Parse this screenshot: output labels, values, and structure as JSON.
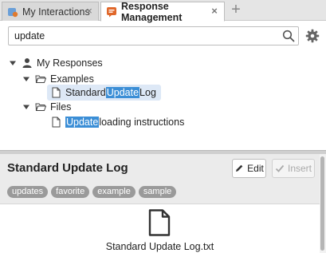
{
  "tabs": [
    {
      "label": "My Interactions",
      "active": false
    },
    {
      "label": "Response Management",
      "active": true
    }
  ],
  "search": {
    "value": "update",
    "placeholder": ""
  },
  "tree": {
    "root": "My Responses",
    "examples": {
      "label": "Examples",
      "item": {
        "before": "Standard ",
        "match": "Update",
        "after": " Log"
      }
    },
    "files": {
      "label": "Files",
      "item": {
        "before": "",
        "match": "Update",
        "after": " loading instructions"
      }
    }
  },
  "detail": {
    "title": "Standard Update Log",
    "edit_label": "Edit",
    "insert_label": "Insert",
    "tags": [
      "updates",
      "favorite",
      "example",
      "sample"
    ],
    "attachment": "Standard Update Log.txt"
  },
  "colors": {
    "highlight": "#3b8ed6",
    "selection": "#dde8f6",
    "tag": "#9a9a9a"
  }
}
